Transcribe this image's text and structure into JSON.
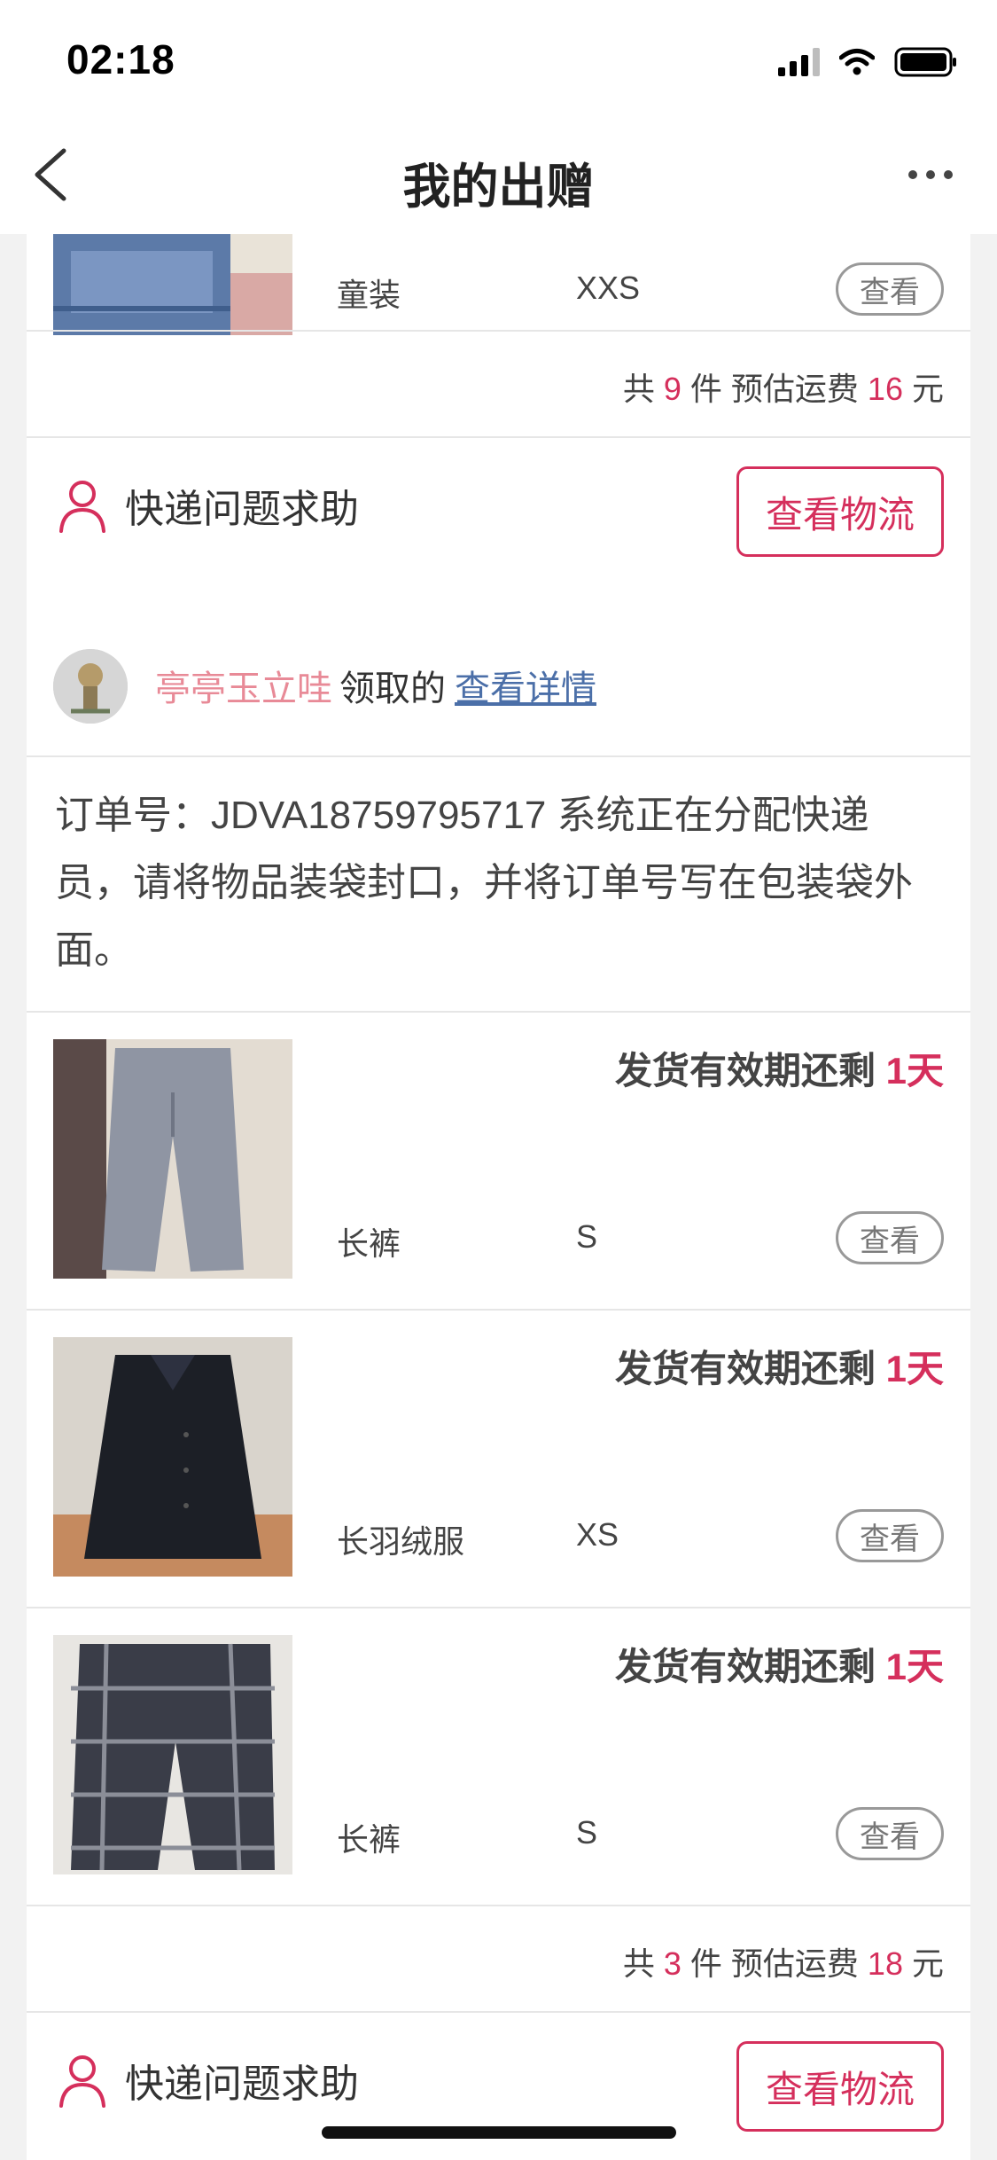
{
  "status_bar": {
    "time": "02:18"
  },
  "nav": {
    "title": "我的出赠"
  },
  "colors": {
    "accent": "#d52f5c",
    "claimer_name": "#e88a97",
    "link": "#4b6fa8"
  },
  "order1": {
    "item": {
      "category": "童装",
      "size": "XXS",
      "view_label": "查看"
    },
    "summary": {
      "prefix": "共",
      "count": "9",
      "unit": "件 预估运费",
      "fee": "16",
      "currency": "元"
    },
    "help_label": "快递问题求助",
    "logistics_label": "查看物流"
  },
  "order2": {
    "claimer_name": "亭亭玉立哇",
    "claimer_verb": "领取的",
    "details_link": "查看详情",
    "order_text": "订单号：JDVA18759795717 系统正在分配快递员，请将物品装袋封口，并将订单号写在包装袋外面。",
    "deadline_label": "发货有效期还剩",
    "items": [
      {
        "category": "长裤",
        "size": "S",
        "days_left": "1天",
        "view_label": "查看"
      },
      {
        "category": "长羽绒服",
        "size": "XS",
        "days_left": "1天",
        "view_label": "查看"
      },
      {
        "category": "长裤",
        "size": "S",
        "days_left": "1天",
        "view_label": "查看"
      }
    ],
    "summary": {
      "prefix": "共",
      "count": "3",
      "unit": "件 预估运费",
      "fee": "18",
      "currency": "元"
    },
    "help_label": "快递问题求助",
    "logistics_label": "查看物流"
  }
}
